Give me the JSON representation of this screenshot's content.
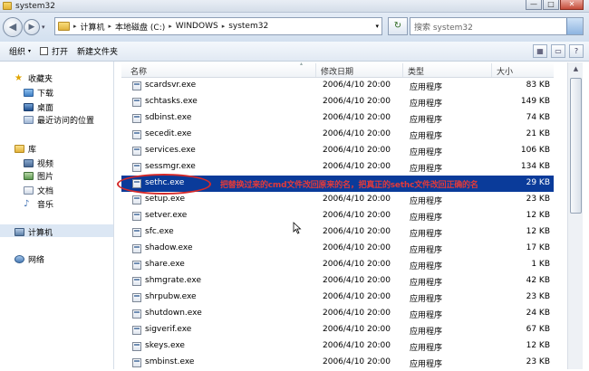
{
  "window": {
    "title": "system32",
    "buttons": {
      "minimize": "—",
      "maximize": "□",
      "close": "✕"
    }
  },
  "nav": {
    "back": "◀",
    "forward": "▶",
    "dropdown": "▾",
    "breadcrumb": [
      "计算机",
      "本地磁盘 (C:)",
      "WINDOWS",
      "system32"
    ],
    "separator": "▸",
    "refresh": "↻",
    "search_placeholder": "搜索 system32"
  },
  "toolbar": {
    "organize": "组织",
    "open": "打开",
    "new_folder": "新建文件夹",
    "arrow": "▾",
    "view": "▦",
    "preview": "▭",
    "help": "?"
  },
  "sidebar": {
    "favorites": "收藏夹",
    "downloads": "下载",
    "desktop": "桌面",
    "recent": "最近访问的位置",
    "libraries": "库",
    "videos": "视频",
    "pictures": "图片",
    "documents": "文档",
    "music": "音乐",
    "computer": "计算机",
    "network": "网络"
  },
  "columns": {
    "name": "名称",
    "modified": "修改日期",
    "type": "类型",
    "size": "大小"
  },
  "files": [
    {
      "name": "scardsvr.exe",
      "date": "2006/4/10 20:00",
      "type": "应用程序",
      "size": "83 KB"
    },
    {
      "name": "schtasks.exe",
      "date": "2006/4/10 20:00",
      "type": "应用程序",
      "size": "149 KB"
    },
    {
      "name": "sdbinst.exe",
      "date": "2006/4/10 20:00",
      "type": "应用程序",
      "size": "74 KB"
    },
    {
      "name": "secedit.exe",
      "date": "2006/4/10 20:00",
      "type": "应用程序",
      "size": "21 KB"
    },
    {
      "name": "services.exe",
      "date": "2006/4/10 20:00",
      "type": "应用程序",
      "size": "106 KB"
    },
    {
      "name": "sessmgr.exe",
      "date": "2006/4/10 20:00",
      "type": "应用程序",
      "size": "134 KB"
    },
    {
      "name": "sethc.exe",
      "date": "",
      "type": "",
      "size": "29 KB"
    },
    {
      "name": "setup.exe",
      "date": "2006/4/10 20:00",
      "type": "应用程序",
      "size": "23 KB"
    },
    {
      "name": "setver.exe",
      "date": "2006/4/10 20:00",
      "type": "应用程序",
      "size": "12 KB"
    },
    {
      "name": "sfc.exe",
      "date": "2006/4/10 20:00",
      "type": "应用程序",
      "size": "12 KB"
    },
    {
      "name": "shadow.exe",
      "date": "2006/4/10 20:00",
      "type": "应用程序",
      "size": "17 KB"
    },
    {
      "name": "share.exe",
      "date": "2006/4/10 20:00",
      "type": "应用程序",
      "size": "1 KB"
    },
    {
      "name": "shmgrate.exe",
      "date": "2006/4/10 20:00",
      "type": "应用程序",
      "size": "42 KB"
    },
    {
      "name": "shrpubw.exe",
      "date": "2006/4/10 20:00",
      "type": "应用程序",
      "size": "23 KB"
    },
    {
      "name": "shutdown.exe",
      "date": "2006/4/10 20:00",
      "type": "应用程序",
      "size": "24 KB"
    },
    {
      "name": "sigverif.exe",
      "date": "2006/4/10 20:00",
      "type": "应用程序",
      "size": "67 KB"
    },
    {
      "name": "skeys.exe",
      "date": "2006/4/10 20:00",
      "type": "应用程序",
      "size": "12 KB"
    },
    {
      "name": "smbinst.exe",
      "date": "2006/4/10 20:00",
      "type": "应用程序",
      "size": "23 KB"
    }
  ],
  "selected_file": "sethc.exe",
  "annotation": "把替换过来的cmd文件改回原来的名，把真正的sethc文件改回正确的名",
  "colors": {
    "selection": "#0a3b9a",
    "annotation_red": "#d52a2a"
  },
  "scrollbar": {
    "up": "▲"
  }
}
